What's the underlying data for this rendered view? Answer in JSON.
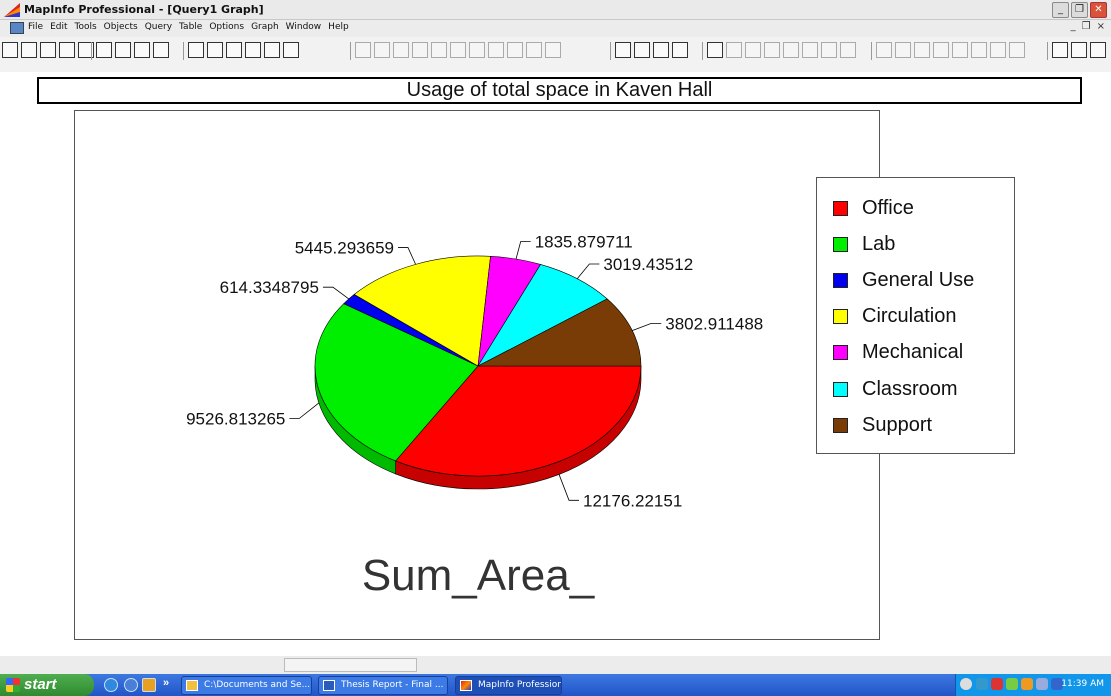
{
  "window": {
    "title": "MapInfo Professional - [Query1 Graph]"
  },
  "menu": [
    "File",
    "Edit",
    "Tools",
    "Objects",
    "Query",
    "Table",
    "Options",
    "Graph",
    "Window",
    "Help"
  ],
  "graph_title": "Usage of total space in Kaven Hall",
  "chart_label": "Sum_Area_",
  "chart_data": {
    "type": "pie",
    "title": "Usage of total space in Kaven Hall",
    "series_name": "Sum_Area_",
    "legend_placement": "right",
    "slices": [
      {
        "label": "Office",
        "value": 12176.22151,
        "value_label": "12176.22151",
        "color": "#ff0000"
      },
      {
        "label": "Lab",
        "value": 9526.813265,
        "value_label": "9526.813265",
        "color": "#00ee00"
      },
      {
        "label": "General Use",
        "value": 614.3348795,
        "value_label": "614.3348795",
        "color": "#0000ee"
      },
      {
        "label": "Circulation",
        "value": 5445.293659,
        "value_label": "5445.293659",
        "color": "#ffff00"
      },
      {
        "label": "Mechanical",
        "value": 1835.879711,
        "value_label": "1835.879711",
        "color": "#ff00ff"
      },
      {
        "label": "Classroom",
        "value": 3019.43512,
        "value_label": "3019.43512",
        "color": "#00ffff"
      },
      {
        "label": "Support",
        "value": 3802.911488,
        "value_label": "3802.911488",
        "color": "#7a3c06"
      }
    ]
  },
  "taskbar": {
    "start_label": "start",
    "tasks": [
      "C:\\Documents and Se...",
      "Thesis Report - Final ...",
      "MapInfo Professional ..."
    ],
    "clock": "11:39 AM"
  }
}
